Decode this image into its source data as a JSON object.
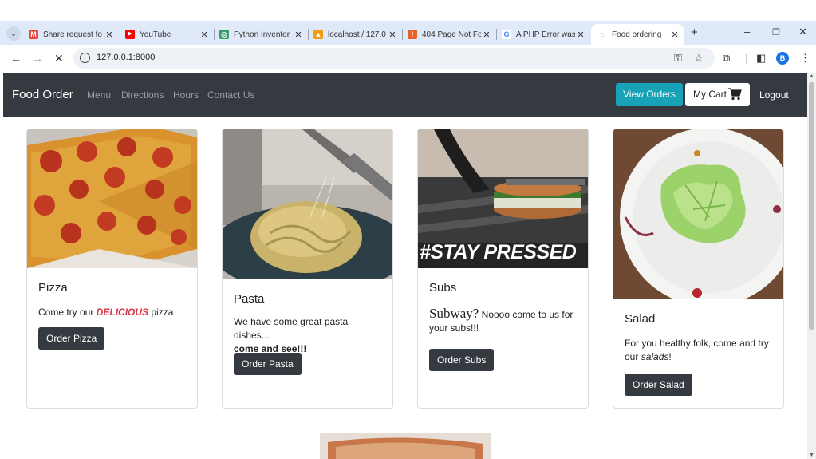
{
  "browser": {
    "tabs": [
      {
        "title": "Share request fo",
        "icon": "gmail-icon"
      },
      {
        "title": "YouTube",
        "icon": "youtube-icon"
      },
      {
        "title": "Python Inventor",
        "icon": "python-icon"
      },
      {
        "title": "localhost / 127.0",
        "icon": "phpmyadmin-icon"
      },
      {
        "title": "404 Page Not Fo",
        "icon": "error-page-icon"
      },
      {
        "title": "A PHP Error was",
        "icon": "google-icon"
      },
      {
        "title": "Food ordering",
        "icon": "loading-icon"
      }
    ],
    "url": "127.0.0.1:8000",
    "profile_initial": "B"
  },
  "site": {
    "brand": "Food Order",
    "nav": [
      "Menu",
      "Directions",
      "Hours",
      "Contact Us"
    ],
    "view_orders": "View Orders",
    "my_cart": "My Cart",
    "logout": "Logout"
  },
  "cards": [
    {
      "title": "Pizza",
      "desc_pre": "Come try our ",
      "desc_em": "DELICIOUS",
      "desc_post": " pizza",
      "button": "Order Pizza"
    },
    {
      "title": "Pasta",
      "desc": "We have some great pasta dishes...",
      "desc_strong": "come and see!!!",
      "button": "Order Pasta"
    },
    {
      "title": "Subs",
      "desc_big": "Subway?",
      "desc": " Noooo come to us for your subs!!!",
      "image_caption": "#STAY PRESSED",
      "button": "Order Subs"
    },
    {
      "title": "Salad",
      "desc_pre": "For you healthy folk, come and try our ",
      "desc_em": "salads",
      "desc_post": "!",
      "button": "Order Salad"
    }
  ],
  "colors": {
    "navbar": "#343a40",
    "info_button": "#17a2b8",
    "danger_text": "#dc3545",
    "tabstrip": "#dfe9f8"
  }
}
